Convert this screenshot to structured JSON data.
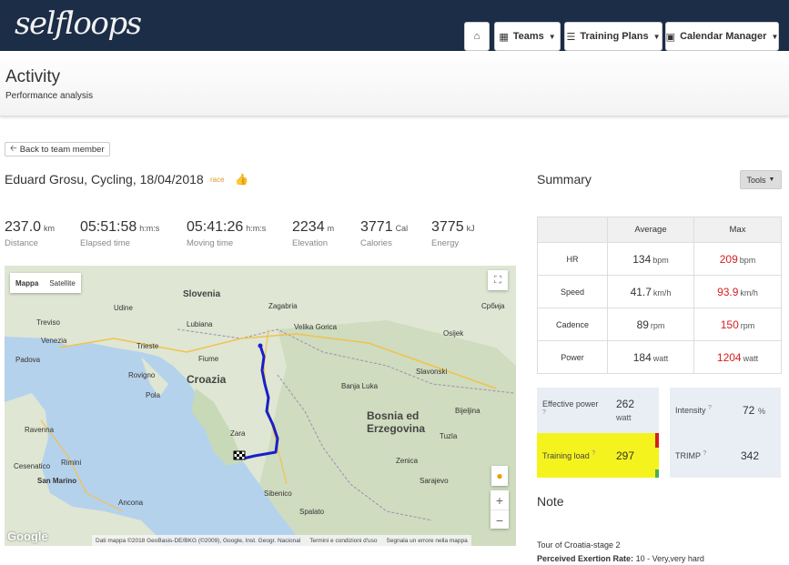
{
  "nav": {
    "logo": "selfloops",
    "home_icon": "home-icon",
    "teams": "Teams",
    "training_plans": "Training Plans",
    "calendar_manager": "Calendar Manager"
  },
  "header": {
    "title": "Activity",
    "subtitle": "Performance analysis"
  },
  "back_button": "Back to team member",
  "activity": {
    "heading": "Eduard Grosu, Cycling, 18/04/2018",
    "tag": "race"
  },
  "stats": [
    {
      "value": "237.0",
      "unit": "km",
      "label": "Distance"
    },
    {
      "value": "05:51:58",
      "unit": "h:m:s",
      "label": "Elapsed time"
    },
    {
      "value": "05:41:26",
      "unit": "h:m:s",
      "label": "Moving time"
    },
    {
      "value": "2234",
      "unit": "m",
      "label": "Elevation"
    },
    {
      "value": "3771",
      "unit": "Cal",
      "label": "Calories"
    },
    {
      "value": "3775",
      "unit": "kJ",
      "label": "Energy"
    }
  ],
  "map": {
    "type_map": "Mappa",
    "type_satellite": "Satellite",
    "labels": {
      "slovenia": "Slovenia",
      "zagabria": "Zagabria",
      "croazia": "Croazia",
      "bosnia1": "Bosnia ed",
      "bosnia2": "Erzegovina",
      "venezia": "Venezia",
      "trieste": "Trieste",
      "fiume": "Fiume",
      "padova": "Padova",
      "ravenna": "Ravenna",
      "rimini": "Rimini",
      "san_marino": "San Marino",
      "ancona": "Ancona",
      "cesena": "Cesenatico",
      "spalato": "Spalato",
      "sarajevo": "Sarajevo",
      "osijek": "Osijek",
      "velika": "Velika Gorica",
      "slavonski": "Slavonski",
      "bijeljina": "Bijeljina",
      "sibenico": "Sibenico",
      "treviso": "Treviso",
      "rovigno": "Rovigno",
      "pola": "Pola",
      "zara": "Zara",
      "tuzla": "Tuzla",
      "udine": "Udine",
      "lubiana": "Lubiana",
      "zenica": "Zenica",
      "banja": "Banja Luka",
      "srbija": "Сpбија"
    },
    "attribution": "Dati mappa ©2018 GeoBasis-DE/BKG (©2009), Google, Inst. Geogr. Nacional",
    "terms": "Termini e condizioni d'uso",
    "report": "Segnala un errore nella mappa",
    "google": "Google"
  },
  "summary": {
    "title": "Summary",
    "tools": "Tools",
    "col_average": "Average",
    "col_max": "Max",
    "rows": [
      {
        "metric": "HR",
        "avg": "134",
        "avg_unit": "bpm",
        "max": "209",
        "max_unit": "bpm"
      },
      {
        "metric": "Speed",
        "avg": "41.7",
        "avg_unit": "km/h",
        "max": "93.9",
        "max_unit": "km/h"
      },
      {
        "metric": "Cadence",
        "avg": "89",
        "avg_unit": "rpm",
        "max": "150",
        "max_unit": "rpm"
      },
      {
        "metric": "Power",
        "avg": "184",
        "avg_unit": "watt",
        "max": "1204",
        "max_unit": "watt"
      }
    ],
    "effective_power_label": "Effective power",
    "effective_power_value": "262",
    "effective_power_unit": "watt",
    "intensity_label": "Intensity",
    "intensity_value": "72",
    "intensity_unit": "%",
    "training_load_label": "Training load",
    "training_load_value": "297",
    "trimp_label": "TRIMP",
    "trimp_value": "342",
    "help_mark": "?"
  },
  "note": {
    "title": "Note",
    "text": "Tour of Croatia-stage 2",
    "pe_label": "Perceived Exertion Rate:",
    "pe_value": "10 - Very,very hard"
  },
  "colors": {
    "navbar": "#1b2d47",
    "max_value": "#d61f1f",
    "training_load_bg": "#f5f31d",
    "route": "#1a1fc8"
  }
}
